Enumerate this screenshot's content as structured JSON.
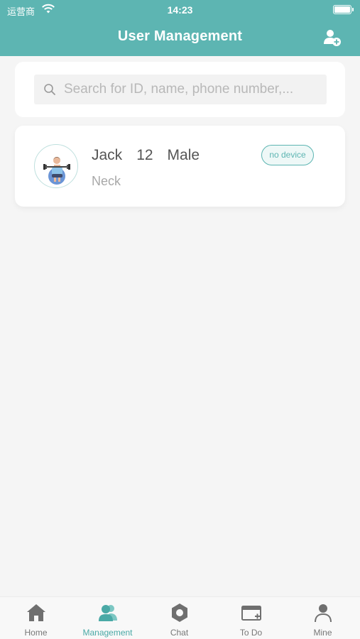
{
  "status_bar": {
    "carrier": "运营商",
    "time": "14:23"
  },
  "header": {
    "title": "User Management",
    "add_user_icon": "add-user-icon"
  },
  "search": {
    "placeholder": "Search for ID, name, phone number,...",
    "value": ""
  },
  "users": [
    {
      "name": "Jack",
      "age": "12",
      "gender": "Male",
      "part": "Neck",
      "device_status": "no device"
    }
  ],
  "tabs": [
    {
      "label": "Home",
      "icon": "home-icon",
      "active": false
    },
    {
      "label": "Management",
      "icon": "users-icon",
      "active": true
    },
    {
      "label": "Chat",
      "icon": "chat-icon",
      "active": false
    },
    {
      "label": "To Do",
      "icon": "todo-icon",
      "active": false
    },
    {
      "label": "Mine",
      "icon": "person-icon",
      "active": false
    }
  ],
  "colors": {
    "accent": "#5db5b2",
    "background": "#f5f5f5",
    "tab_inactive": "#777777"
  }
}
